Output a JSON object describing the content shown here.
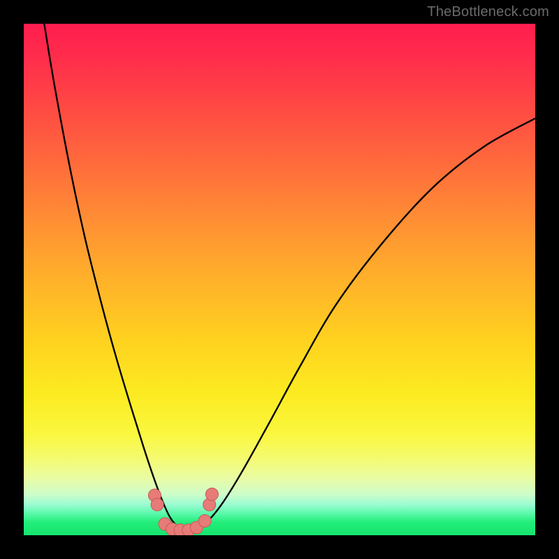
{
  "watermark": {
    "text": "TheBottleneck.com"
  },
  "colors": {
    "frame": "#000000",
    "curve_stroke": "#000000",
    "marker_fill": "#e77b77",
    "marker_stroke": "#c55a56",
    "gradient_top": "#ff1d4f",
    "gradient_bottom": "#16e56f"
  },
  "chart_data": {
    "type": "line",
    "title": "",
    "xlabel": "",
    "ylabel": "",
    "xlim": [
      0,
      1
    ],
    "ylim": [
      0,
      1
    ],
    "note": "Axes are not labeled in the source image; x and y are normalized to the plot area. The curve shape and marker positions are estimated from the pixels.",
    "series": [
      {
        "name": "curve",
        "kind": "line",
        "x": [
          0.04,
          0.06,
          0.09,
          0.12,
          0.15,
          0.18,
          0.21,
          0.235,
          0.255,
          0.272,
          0.286,
          0.3,
          0.315,
          0.335,
          0.36,
          0.39,
          0.43,
          0.48,
          0.54,
          0.61,
          0.7,
          0.8,
          0.9,
          1.0
        ],
        "y": [
          1.0,
          0.88,
          0.72,
          0.58,
          0.46,
          0.35,
          0.25,
          0.17,
          0.11,
          0.065,
          0.035,
          0.018,
          0.01,
          0.012,
          0.028,
          0.065,
          0.13,
          0.22,
          0.33,
          0.45,
          0.57,
          0.68,
          0.76,
          0.815
        ]
      },
      {
        "name": "markers",
        "kind": "scatter",
        "x": [
          0.256,
          0.261,
          0.276,
          0.29,
          0.306,
          0.322,
          0.338,
          0.354,
          0.363,
          0.368
        ],
        "y": [
          0.078,
          0.06,
          0.022,
          0.012,
          0.01,
          0.01,
          0.015,
          0.028,
          0.06,
          0.08
        ]
      }
    ]
  }
}
